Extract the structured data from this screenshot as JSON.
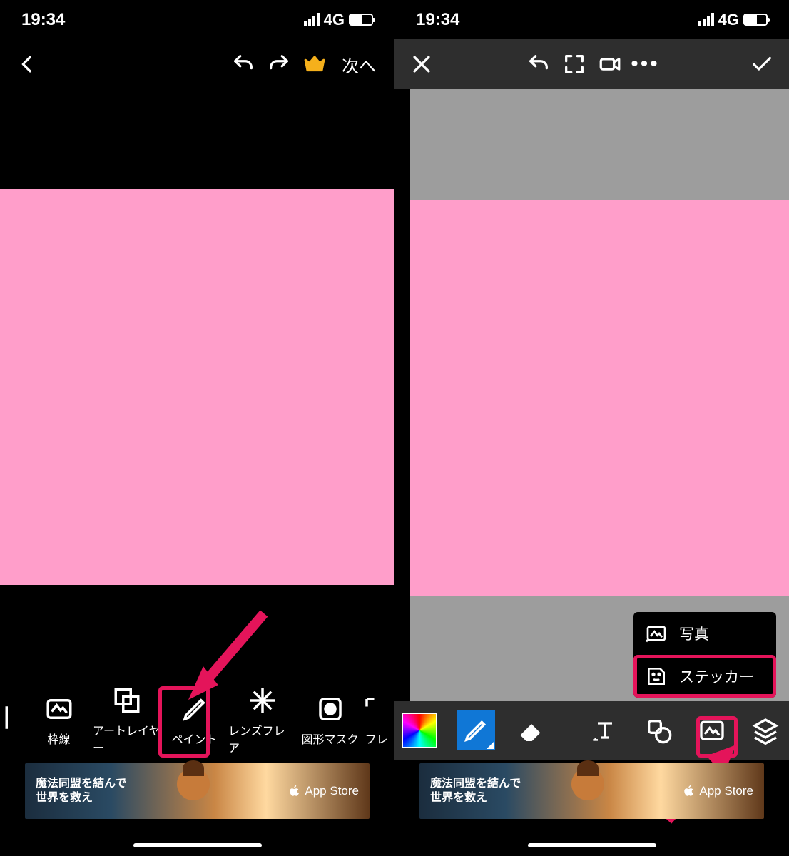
{
  "status": {
    "time": "19:34",
    "network": "4G"
  },
  "left": {
    "next_label": "次へ",
    "tools": [
      {
        "label": "枠線"
      },
      {
        "label": "アートレイヤー"
      },
      {
        "label": "ペイント"
      },
      {
        "label": "レンズフレア"
      },
      {
        "label": "図形マスク"
      },
      {
        "label": "フレ"
      }
    ]
  },
  "right": {
    "popup": {
      "photo": "写真",
      "sticker": "ステッカー"
    }
  },
  "ad": {
    "line1": "魔法同盟を結んで",
    "line2": "世界を救え",
    "store": "App Store"
  },
  "colors": {
    "pink": "#ff9eca",
    "accent": "#e4145a",
    "crown": "#f5b01b"
  }
}
